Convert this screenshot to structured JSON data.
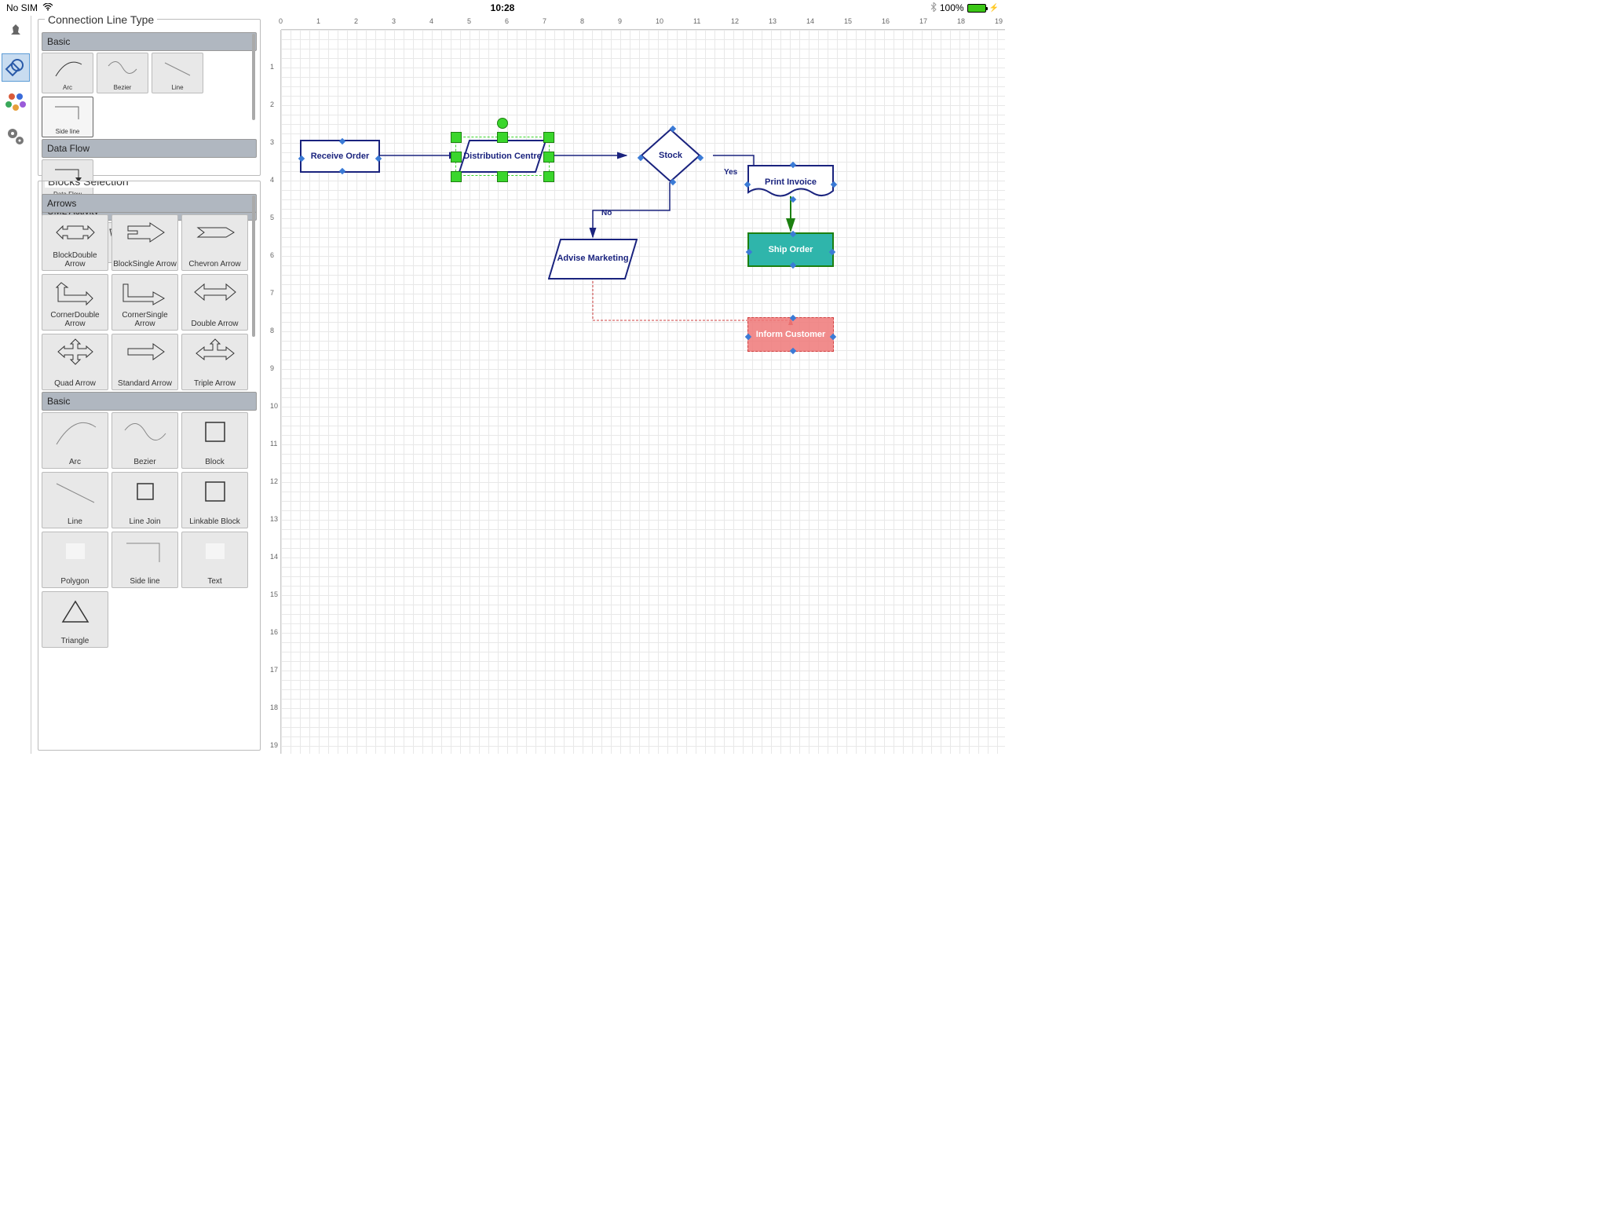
{
  "status": {
    "no_sim": "No SIM",
    "time": "10:28",
    "battery": "100%"
  },
  "toolbar": {
    "pin": "pin",
    "shapes": "shapes",
    "colors": "colors",
    "settings": "settings"
  },
  "connection_panel": {
    "title": "Connection Line Type",
    "groups": [
      {
        "name": "Basic",
        "items": [
          "Arc",
          "Bezier",
          "Line",
          "Side line"
        ],
        "selected": 3
      },
      {
        "name": "Data Flow",
        "items": [
          "Data Flow"
        ]
      },
      {
        "name": "UML Activity",
        "items": [
          "",
          ""
        ]
      }
    ]
  },
  "blocks_panel": {
    "title": "Blocks Selection",
    "groups": [
      {
        "name": "Arrows",
        "items": [
          "BlockDouble Arrow",
          "BlockSingle Arrow",
          "Chevron Arrow",
          "CornerDouble Arrow",
          "CornerSingle Arrow",
          "Double Arrow",
          "Quad Arrow",
          "Standard Arrow",
          "Triple Arrow"
        ]
      },
      {
        "name": "Basic",
        "items": [
          "Arc",
          "Bezier",
          "Block",
          "Line",
          "Line Join",
          "Linkable Block",
          "Polygon",
          "Side line",
          "Text",
          "Triangle"
        ]
      }
    ]
  },
  "flowchart": {
    "nodes": {
      "receive": "Receive Order",
      "dist": "Distribution Centre",
      "stock": "Stock",
      "print": "Print Invoice",
      "ship": "Ship Order",
      "advise": "Advise Marketing",
      "inform": "Inform Customer"
    },
    "labels": {
      "yes": "Yes",
      "no": "No"
    }
  }
}
